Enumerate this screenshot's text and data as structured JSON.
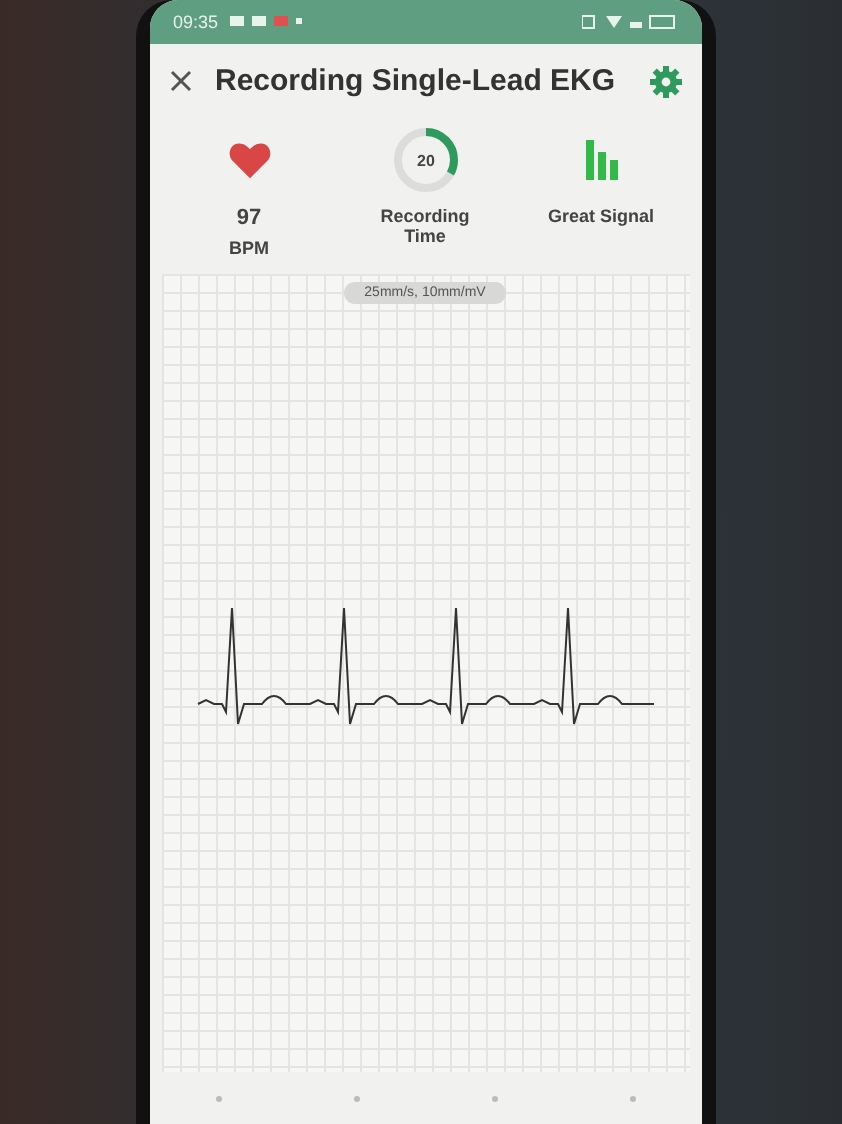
{
  "status_bar": {
    "time": "09:35"
  },
  "header": {
    "title": "Recording Single-Lead EKG"
  },
  "stats": [
    {
      "kind": "heart",
      "value": "97",
      "label": "BPM"
    },
    {
      "kind": "timer",
      "value": "20",
      "label": "Recording Time",
      "level": 0.33
    },
    {
      "kind": "signal",
      "label": "Great Signal"
    }
  ],
  "chart": {
    "scale": "25mm/s, 10mm/mV"
  }
}
